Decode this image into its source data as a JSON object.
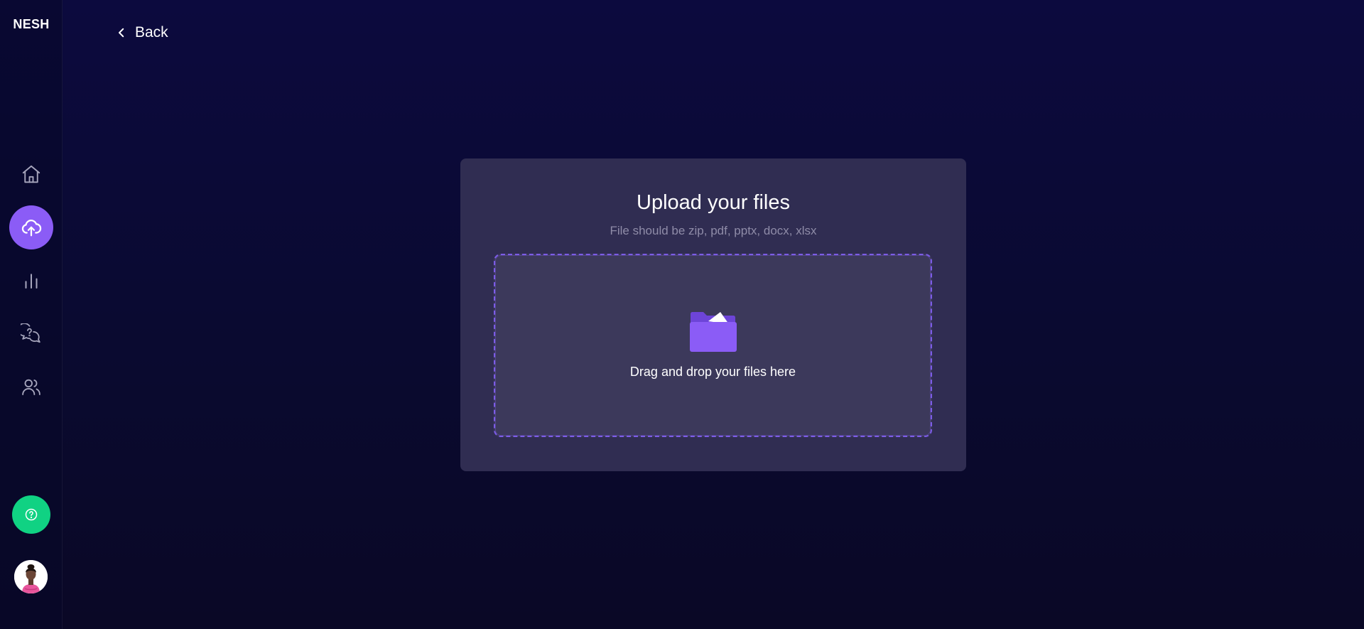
{
  "app": {
    "logo": "NESH"
  },
  "colors": {
    "accent": "#8b5cf6",
    "help": "#10d283",
    "background": "#0c0a3e",
    "card": "#302d52",
    "dropzone": "#3c395b"
  },
  "sidebar": {
    "items": [
      {
        "name": "home",
        "icon": "home-icon",
        "active": false
      },
      {
        "name": "upload",
        "icon": "cloud-upload-icon",
        "active": true
      },
      {
        "name": "analytics",
        "icon": "bar-chart-icon",
        "active": false
      },
      {
        "name": "questions",
        "icon": "question-chat-icon",
        "active": false
      },
      {
        "name": "users",
        "icon": "users-icon",
        "active": false
      }
    ],
    "help_icon": "help-icon",
    "avatar_icon": "user-avatar"
  },
  "header": {
    "back_label": "Back"
  },
  "upload": {
    "title": "Upload your files",
    "subtitle": "File should be zip, pdf, pptx, docx, xlsx",
    "dropzone_text": "Drag and drop your files here",
    "folder_icon": "folder-icon"
  }
}
